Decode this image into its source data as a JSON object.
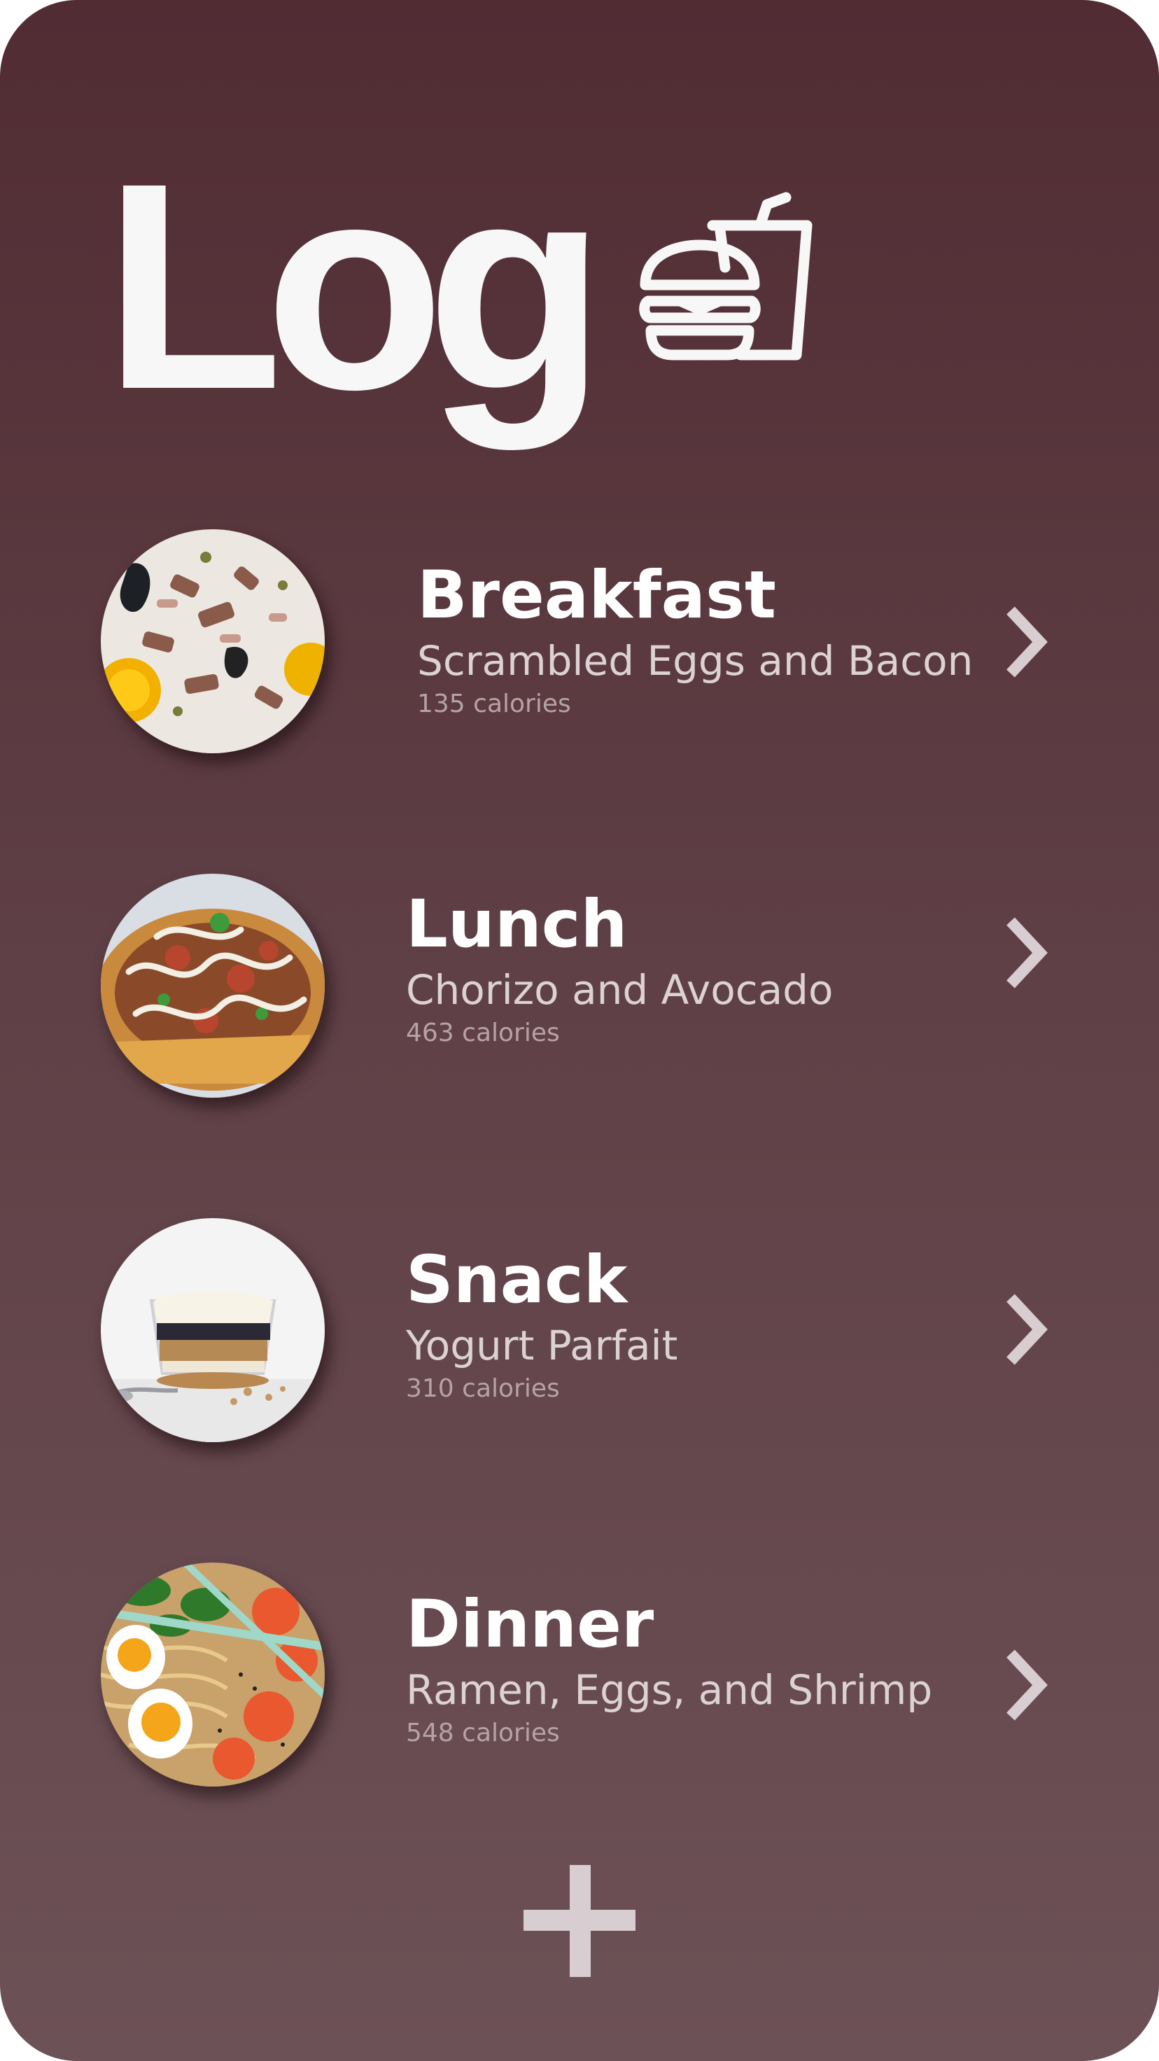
{
  "header": {
    "title": "Log",
    "icon": "burger-drink-icon"
  },
  "meals": [
    {
      "name": "Breakfast",
      "description": "Scrambled Eggs and Bacon",
      "calories": "135 calories",
      "photo": "eggs-bacon-photo"
    },
    {
      "name": "Lunch",
      "description": "Chorizo and Avocado",
      "calories": "463 calories",
      "photo": "nachos-photo"
    },
    {
      "name": "Snack",
      "description": "Yogurt Parfait",
      "calories": "310 calories",
      "photo": "parfait-photo"
    },
    {
      "name": "Dinner",
      "description": "Ramen, Eggs, and Shrimp",
      "calories": "548 calories",
      "photo": "ramen-photo"
    }
  ],
  "actions": {
    "row_icon": "chevron-right-icon",
    "add_icon": "plus-icon"
  },
  "colors": {
    "background_top": "#512c33",
    "background_bottom": "#6c5156",
    "accent": "#d8cdd0"
  }
}
